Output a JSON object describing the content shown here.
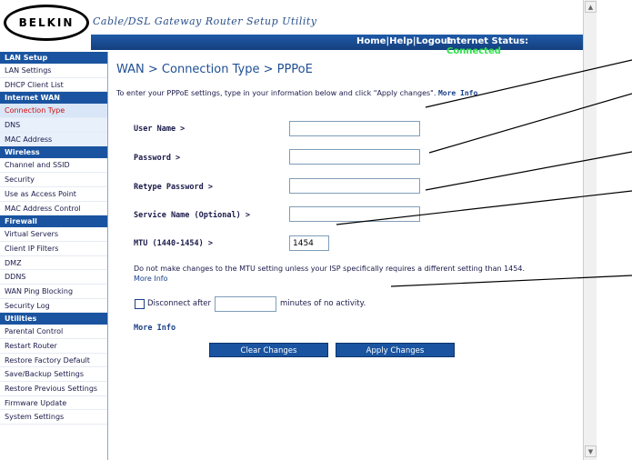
{
  "header": {
    "logo_text": "BELKIN",
    "title": "Cable/DSL Gateway Router Setup Utility",
    "links": [
      "Home",
      "Help",
      "Logout"
    ],
    "status_label": "Internet Status:",
    "status_value": "Connected",
    "status_color": "#2fe04b"
  },
  "sidebar": {
    "sections": [
      {
        "title": "LAN Setup",
        "items": [
          "LAN Settings",
          "DHCP Client List"
        ]
      },
      {
        "title": "Internet WAN",
        "items": [
          "Connection Type",
          "DNS",
          "MAC Address"
        ]
      },
      {
        "title": "Wireless",
        "items": [
          "Channel and SSID",
          "Security",
          "Use as Access Point",
          "MAC Address Control"
        ]
      },
      {
        "title": "Firewall",
        "items": [
          "Virtual Servers",
          "Client IP Filters",
          "DMZ",
          "DDNS",
          "WAN Ping Blocking",
          "Security Log"
        ]
      },
      {
        "title": "Utilities",
        "items": [
          "Parental Control",
          "Restart Router",
          "Restore Factory Default",
          "Save/Backup Settings",
          "Restore Previous Settings",
          "Firmware Update",
          "System Settings"
        ]
      }
    ],
    "active_item": "Connection Type",
    "active_color": "#d01010"
  },
  "main": {
    "title": "WAN > Connection Type > PPPoE",
    "intro": "To enter your PPPoE settings, type in your information below and click \"Apply changes\".",
    "intro_more": "More Info",
    "fields": {
      "user_name_label": "User Name >",
      "user_name_value": "",
      "password_label": "Password >",
      "password_value": "",
      "retype_password_label": "Retype Password >",
      "retype_password_value": "",
      "service_name_label": "Service Name (Optional) >",
      "service_name_value": "",
      "mtu_label": "MTU (1440-1454) >",
      "mtu_value": "1454"
    },
    "mtu_note": "Do not make changes to the MTU setting unless your ISP specifically requires a different setting than 1454.",
    "mtu_note_more": "More Info",
    "disconnect_prefix": "Disconnect after",
    "disconnect_value": "",
    "disconnect_suffix": "minutes of no activity.",
    "disconnect_checked": false,
    "more_info": "More Info",
    "clear_button": "Clear Changes",
    "apply_button": "Apply Changes"
  },
  "colors": {
    "nav_blue": "#1a54a0",
    "title_blue": "#1f4f93"
  }
}
